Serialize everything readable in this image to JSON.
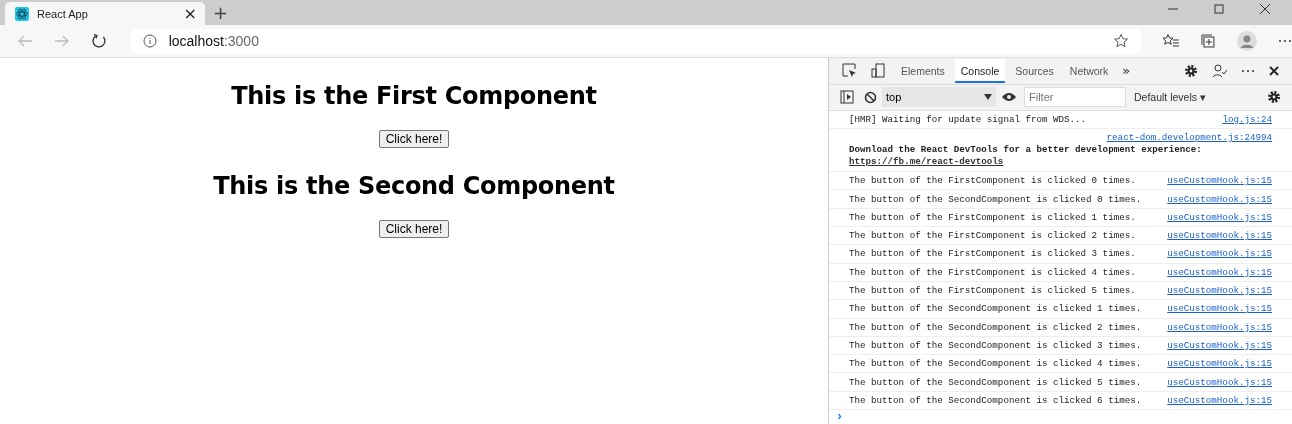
{
  "browser": {
    "tab": {
      "title": "React App",
      "close": "×"
    },
    "new_tab": "+",
    "address": {
      "host": "localhost",
      "port": ":3000"
    }
  },
  "page": {
    "components": [
      {
        "heading": "This is the First Component",
        "button": "Click here!"
      },
      {
        "heading": "This is the Second Component",
        "button": "Click here!"
      }
    ]
  },
  "devtools": {
    "tabs": [
      {
        "label": "Elements",
        "selected": false
      },
      {
        "label": "Console",
        "selected": true
      },
      {
        "label": "Sources",
        "selected": false
      },
      {
        "label": "Network",
        "selected": false
      }
    ],
    "more": "»",
    "toolbar": {
      "context": "top",
      "filter_placeholder": "Filter",
      "levels": "Default levels ▾"
    },
    "messages": [
      {
        "kind": "log",
        "text": "[HMR] Waiting for update signal from WDS...",
        "source": "log.js:24"
      },
      {
        "kind": "info",
        "text": "Download the React DevTools for a better development experience: ",
        "link": "https://fb.me/react-devtools",
        "source": "react-dom.development.js:24994"
      },
      {
        "kind": "log",
        "text": "The button of the FirstComponent is clicked 0 times.",
        "source": "useCustomHook.js:15"
      },
      {
        "kind": "log",
        "text": "The button of the SecondComponent is clicked 0 times.",
        "source": "useCustomHook.js:15"
      },
      {
        "kind": "log",
        "text": "The button of the FirstComponent is clicked 1 times.",
        "source": "useCustomHook.js:15"
      },
      {
        "kind": "log",
        "text": "The button of the FirstComponent is clicked 2 times.",
        "source": "useCustomHook.js:15"
      },
      {
        "kind": "log",
        "text": "The button of the FirstComponent is clicked 3 times.",
        "source": "useCustomHook.js:15"
      },
      {
        "kind": "log",
        "text": "The button of the FirstComponent is clicked 4 times.",
        "source": "useCustomHook.js:15"
      },
      {
        "kind": "log",
        "text": "The button of the FirstComponent is clicked 5 times.",
        "source": "useCustomHook.js:15"
      },
      {
        "kind": "log",
        "text": "The button of the SecondComponent is clicked 1 times.",
        "source": "useCustomHook.js:15"
      },
      {
        "kind": "log",
        "text": "The button of the SecondComponent is clicked 2 times.",
        "source": "useCustomHook.js:15"
      },
      {
        "kind": "log",
        "text": "The button of the SecondComponent is clicked 3 times.",
        "source": "useCustomHook.js:15"
      },
      {
        "kind": "log",
        "text": "The button of the SecondComponent is clicked 4 times.",
        "source": "useCustomHook.js:15"
      },
      {
        "kind": "log",
        "text": "The button of the SecondComponent is clicked 5 times.",
        "source": "useCustomHook.js:15"
      },
      {
        "kind": "log",
        "text": "The button of the SecondComponent is clicked 6 times.",
        "source": "useCustomHook.js:15"
      }
    ],
    "prompt": "›"
  }
}
